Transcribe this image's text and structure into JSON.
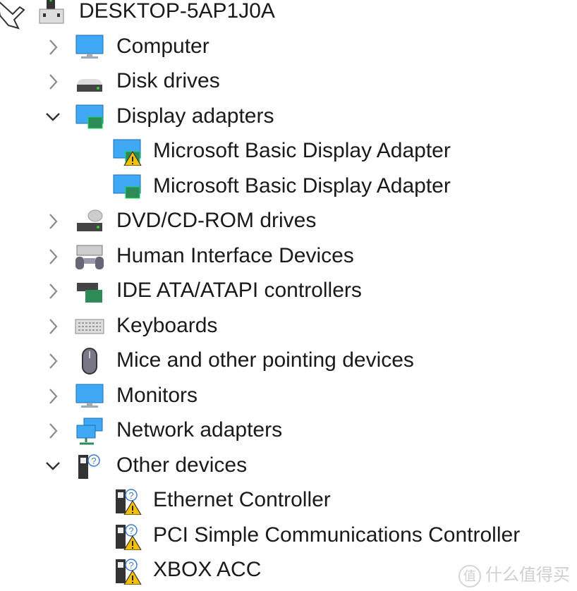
{
  "tree": {
    "root": {
      "label": "DESKTOP-5AP1J0A",
      "icon": "computer-tower-icon"
    },
    "items": [
      {
        "label": "Computer",
        "level": 1,
        "state": "collapsed",
        "icon": "monitor-icon"
      },
      {
        "label": "Disk drives",
        "level": 1,
        "state": "collapsed",
        "icon": "disk-drive-icon"
      },
      {
        "label": "Display adapters",
        "level": 1,
        "state": "expanded",
        "icon": "display-adapter-icon"
      },
      {
        "label": "Microsoft Basic Display Adapter",
        "level": 2,
        "icon": "display-adapter-warning-icon"
      },
      {
        "label": "Microsoft Basic Display Adapter",
        "level": 2,
        "icon": "display-adapter-icon"
      },
      {
        "label": "DVD/CD-ROM drives",
        "level": 1,
        "state": "collapsed",
        "icon": "dvd-drive-icon"
      },
      {
        "label": "Human Interface Devices",
        "level": 1,
        "state": "collapsed",
        "icon": "hid-icon"
      },
      {
        "label": "IDE ATA/ATAPI controllers",
        "level": 1,
        "state": "collapsed",
        "icon": "ide-controller-icon"
      },
      {
        "label": "Keyboards",
        "level": 1,
        "state": "collapsed",
        "icon": "keyboard-icon"
      },
      {
        "label": "Mice and other pointing devices",
        "level": 1,
        "state": "collapsed",
        "icon": "mouse-icon"
      },
      {
        "label": "Monitors",
        "level": 1,
        "state": "collapsed",
        "icon": "monitor-icon"
      },
      {
        "label": "Network adapters",
        "level": 1,
        "state": "collapsed",
        "icon": "network-adapter-icon"
      },
      {
        "label": "Other devices",
        "level": 1,
        "state": "expanded",
        "icon": "unknown-device-icon"
      },
      {
        "label": "Ethernet Controller",
        "level": 2,
        "icon": "unknown-device-warning-icon"
      },
      {
        "label": "PCI Simple Communications Controller",
        "level": 2,
        "icon": "unknown-device-warning-icon"
      },
      {
        "label": "XBOX ACC",
        "level": 2,
        "icon": "unknown-device-warning-icon"
      }
    ]
  },
  "watermark": {
    "logo_char": "值",
    "text": "什么值得买"
  },
  "colors": {
    "text": "#1a1a1a",
    "chevron": "#8a8a8a",
    "screen_blue": "#3fa9f5",
    "board_green": "#2e8b57",
    "warning": "#f5c000"
  }
}
